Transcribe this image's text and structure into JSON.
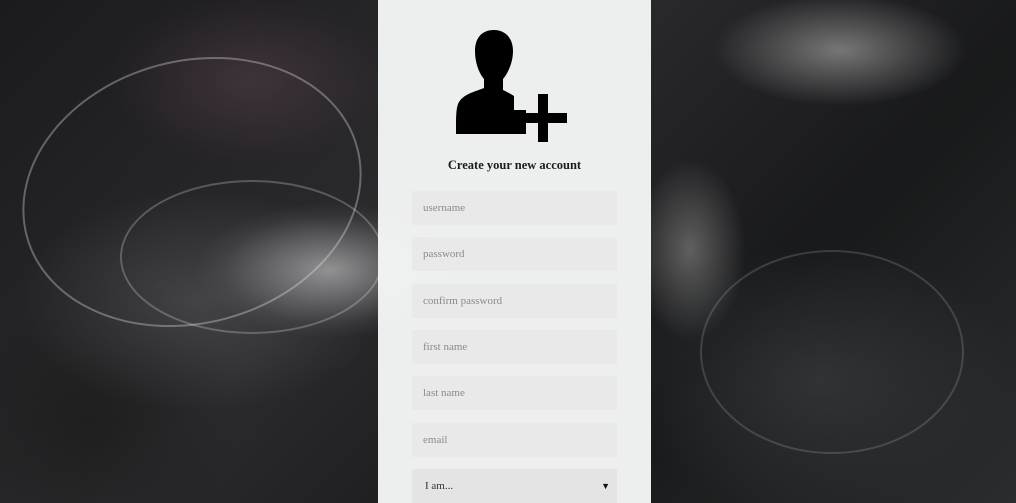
{
  "form": {
    "title": "Create your new account",
    "fields": [
      {
        "name": "username",
        "placeholder": "username"
      },
      {
        "name": "password",
        "placeholder": "password"
      },
      {
        "name": "confirm_password",
        "placeholder": "confirm password"
      },
      {
        "name": "first_name",
        "placeholder": "first name"
      },
      {
        "name": "last_name",
        "placeholder": "last name"
      },
      {
        "name": "email",
        "placeholder": "email"
      }
    ],
    "role_select": {
      "value": "I am..."
    }
  },
  "icons": {
    "logo": "add-user-icon",
    "select_arrow": "triangle-down-icon"
  },
  "colors": {
    "panel_bg": "#f6f7f7",
    "field_bg": "#e9e9e9",
    "text": "#1c1c1c"
  }
}
